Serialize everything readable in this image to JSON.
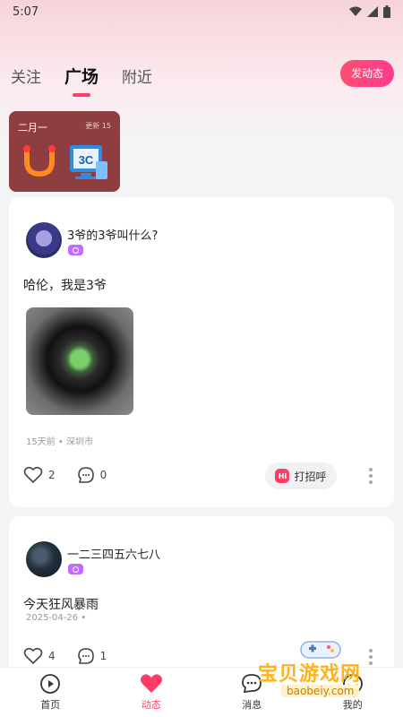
{
  "status_bar": {
    "time": "5:07"
  },
  "tabs": [
    {
      "label": "关注",
      "active": false
    },
    {
      "label": "广场",
      "active": true
    },
    {
      "label": "附近",
      "active": false
    }
  ],
  "post_button_label": "发动态",
  "promo": {
    "left_text": "二月一",
    "right_text": "更新 15"
  },
  "posts": [
    {
      "username": "3爷的3爷叫什么?",
      "text": "哈伦，我是3爷",
      "meta": "15天前 • 深圳市",
      "likes": "2",
      "comments": "0",
      "greet_label": "打招呼",
      "greet_icon_text": "Hi"
    },
    {
      "username": "一二三四五六七八",
      "text": "今天狂风暴雨",
      "meta": "2025-04-26 •",
      "likes": "4",
      "comments": "1"
    }
  ],
  "bottom_nav": [
    {
      "label": "首页",
      "icon": "home-icon"
    },
    {
      "label": "动态",
      "icon": "heart-icon",
      "active": true
    },
    {
      "label": "消息",
      "icon": "message-icon"
    },
    {
      "label": "我的",
      "icon": "profile-icon"
    }
  ],
  "watermark": {
    "text": "宝贝游戏网",
    "url": "baobeiy.com"
  },
  "colors": {
    "accent": "#ff3b68",
    "promo_bg": "#8e3e40"
  }
}
